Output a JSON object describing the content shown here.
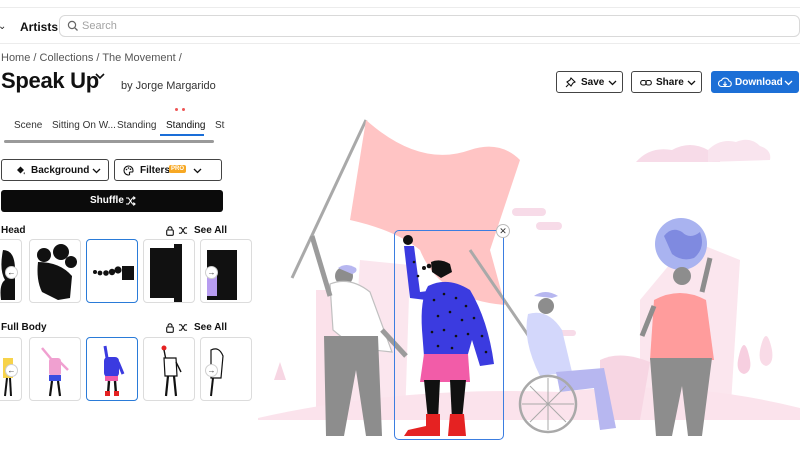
{
  "nav": {
    "artists_label": "Artists"
  },
  "search": {
    "placeholder": "Search",
    "value": ""
  },
  "breadcrumb": {
    "items": [
      "Home",
      "Collections",
      "The Movement"
    ],
    "separator": " / "
  },
  "page": {
    "title": "Speak Up",
    "byline": "by Jorge Margarido"
  },
  "actions": {
    "save_label": "Save",
    "share_label": "Share",
    "download_label": "Download"
  },
  "tabs": [
    "Scene",
    "Sitting On W...",
    "Standing",
    "Standing",
    "St"
  ],
  "active_tab_index": 3,
  "controls": {
    "background_label": "Background",
    "filters_label": "Filters",
    "pro_badge": "PRO",
    "shuffle_label": "Shuffle"
  },
  "sections": {
    "head": {
      "title": "Head",
      "see_all": "See All"
    },
    "full_body": {
      "title": "Full Body",
      "see_all": "See All"
    }
  },
  "colors": {
    "accent": "#1c6fd6",
    "pro_badge": "#f7a823",
    "selection": "#3b7de0",
    "flag": "#ffc2c2",
    "hills": "#fbe6ee"
  },
  "icons": [
    "chevron-down-icon",
    "search-icon",
    "pin-icon",
    "link-icon",
    "cloud-download-icon",
    "paint-bucket-icon",
    "palette-icon",
    "shuffle-icon",
    "lock-icon",
    "arrow-left-icon",
    "arrow-right-icon",
    "close-icon"
  ]
}
